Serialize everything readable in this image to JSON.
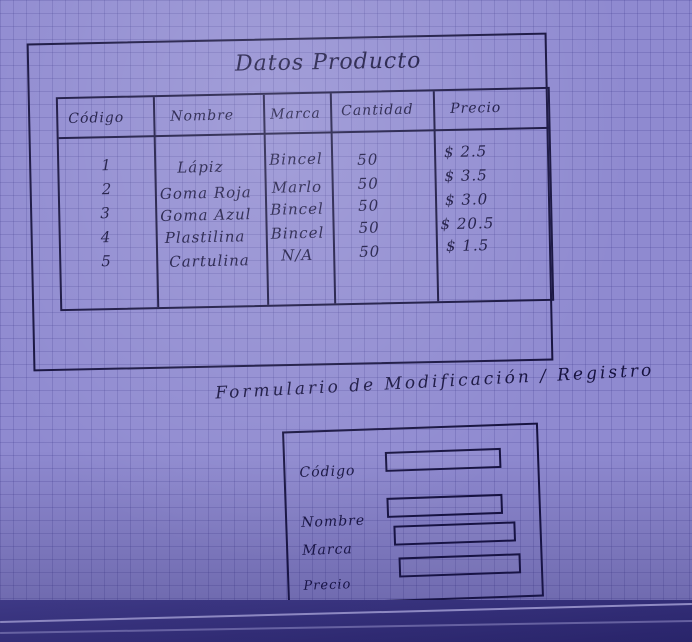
{
  "sketch": {
    "table_title": "Datos Producto",
    "columns": [
      "Código",
      "Nombre",
      "Marca",
      "Cantidad",
      "Precio"
    ],
    "rows": [
      [
        "1",
        "Lápiz",
        "Bincel",
        "50",
        "$ 2.5"
      ],
      [
        "2",
        "Goma Roja",
        "Marlo",
        "50",
        "$ 3.5"
      ],
      [
        "3",
        "Goma Azul",
        "Bincel",
        "50",
        "$ 3.0"
      ],
      [
        "4",
        "Plastilina",
        "Bincel",
        "50",
        "$ 20.5"
      ],
      [
        "5",
        "Cartulina",
        "N/A",
        "50",
        "$ 1.5"
      ]
    ],
    "form_title": "Formulario de Modificación / Registro",
    "form_fields": [
      {
        "label": "Código"
      },
      {
        "label": "Nombre"
      },
      {
        "label": "Marca"
      },
      {
        "label": "Precio"
      }
    ]
  }
}
